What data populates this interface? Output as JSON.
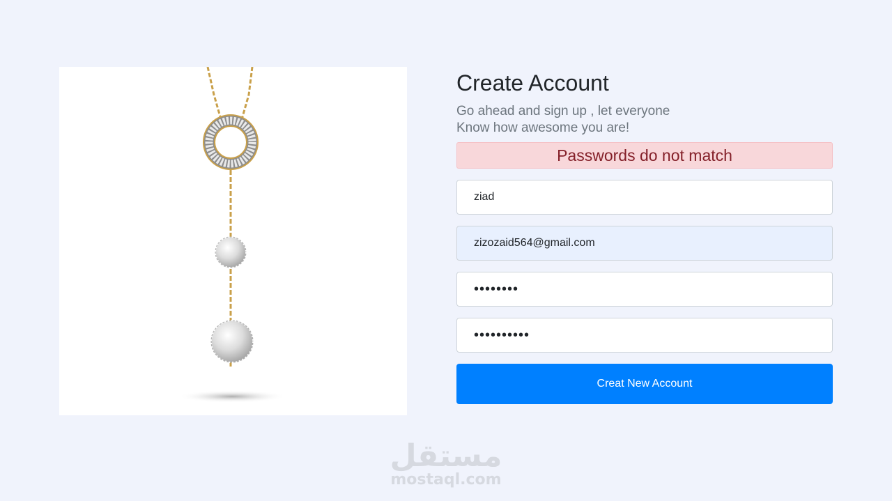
{
  "product_image": {
    "alt": "Gold necklace with crystal ring pendant and crystal balls"
  },
  "form": {
    "title": "Create Account",
    "subtitle_line1": "Go ahead and sign up , let everyone",
    "subtitle_line2": "Know how awesome you are!",
    "error_message": "Passwords do not match",
    "name_value": "ziad",
    "email_value": "zizozaid564@gmail.com",
    "password_value": "abc12345",
    "confirm_password_value": "abc1234567",
    "submit_label": "Creat New Account"
  },
  "watermark": {
    "arabic": "مستقل",
    "latin": "mostaql.com"
  },
  "colors": {
    "background": "#f0f3fc",
    "accent": "#0080ff",
    "error_bg": "#f8d7da",
    "error_text": "#842029",
    "autofill_bg": "#e8f0fe"
  }
}
